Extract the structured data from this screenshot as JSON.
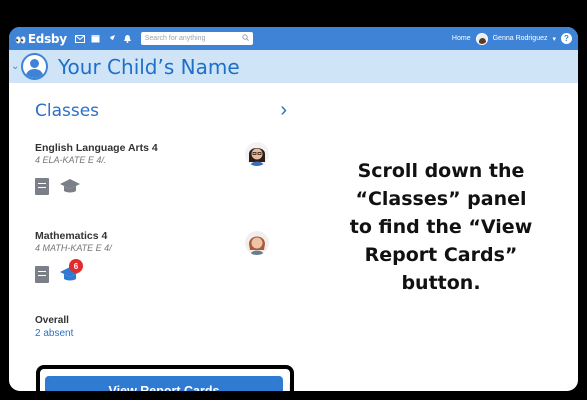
{
  "topbar": {
    "logo": "Edsby",
    "search_placeholder": "Search for anything",
    "home_label": "Home",
    "user_name": "Genna Rodriguez",
    "user_caret": "▾"
  },
  "child": {
    "name": "Your Child’s Name"
  },
  "classes_panel": {
    "title": "Classes",
    "chevron": "›",
    "courses": [
      {
        "name": "English Language Arts 4",
        "code": "4 ELA-KATE E 4/.",
        "badge": ""
      },
      {
        "name": "Mathematics 4",
        "code": "4 MATH-KATE E 4/",
        "badge": "6"
      }
    ],
    "overall_label": "Overall",
    "overall_value": "2 absent",
    "report_button": "View Report Cards"
  },
  "instruction": {
    "line1": "Scroll down the",
    "line2": "“Classes” panel",
    "line3": "to find the “View",
    "line4": "Report Cards”",
    "line5": "button."
  },
  "colors": {
    "topbar": "#3f83d6",
    "childbar": "#cfe4f7",
    "accent": "#2f7bd2",
    "badge": "#e32b2b"
  },
  "icons": [
    "eyes-logo-icon",
    "mail-icon",
    "calendar-icon",
    "rocket-icon",
    "bell-icon",
    "search-icon",
    "help-icon",
    "document-icon",
    "graduation-cap-icon",
    "chevron-right-icon",
    "chevron-down-icon",
    "child-avatar-icon"
  ]
}
